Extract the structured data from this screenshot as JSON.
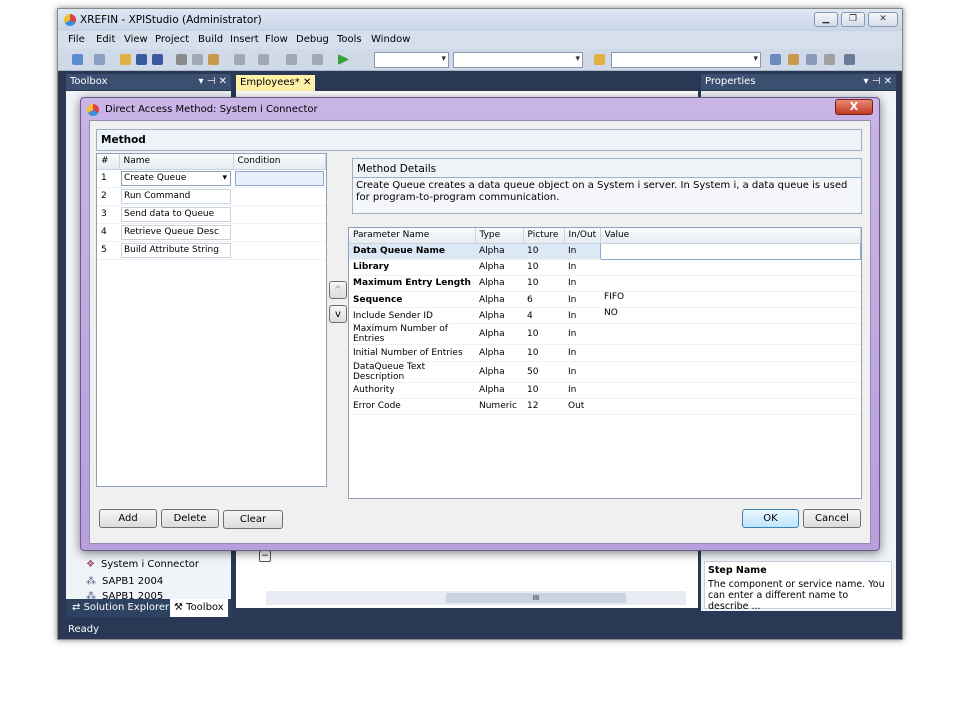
{
  "window": {
    "title": "XREFIN - XPIStudio (Administrator)"
  },
  "menu": [
    "File",
    "Edit",
    "View",
    "Project",
    "Build",
    "Insert",
    "Flow",
    "Debug",
    "Tools",
    "Window"
  ],
  "panels": {
    "toolbox_title": "Toolbox",
    "document_tab": "Employees*",
    "properties_title": "Properties",
    "toolbox_items": [
      "System i Connector",
      "SAPB1 2004",
      "SAPB1 2005"
    ],
    "bottom_tabs": [
      "Solution Explorer",
      "Toolbox"
    ],
    "scroll_center": "III",
    "step_name_title": "Step Name",
    "step_name_desc": "The component or service  name. You can enter a different name to describe ..."
  },
  "status": "Ready",
  "dialog": {
    "title": "Direct Access Method: System i Connector",
    "close_label": "X",
    "method_header": "Method",
    "method_columns": [
      "#",
      "Name",
      "Condition"
    ],
    "methods": [
      {
        "num": "1",
        "name": "Create Queue",
        "condition": ""
      },
      {
        "num": "2",
        "name": "Run Command",
        "condition": ""
      },
      {
        "num": "3",
        "name": "Send data to Queue",
        "condition": ""
      },
      {
        "num": "4",
        "name": "Retrieve Queue Desc",
        "condition": ""
      },
      {
        "num": "5",
        "name": "Build Attribute String",
        "condition": ""
      }
    ],
    "up_label": "^",
    "down_label": "v",
    "details_header": "Method Details",
    "details_text": "Create Queue creates a data queue object on a System i server. In System i, a data queue is used for program-to-program communication.",
    "param_columns": [
      "Parameter Name",
      "Type",
      "Picture",
      "In/Out",
      "Value"
    ],
    "params": [
      {
        "name": "Data Queue Name",
        "bold": true,
        "type": "Alpha",
        "picture": "10",
        "inout": "In",
        "value": ""
      },
      {
        "name": "Library",
        "bold": true,
        "type": "Alpha",
        "picture": "10",
        "inout": "In",
        "value": ""
      },
      {
        "name": "Maximum Entry Length",
        "bold": true,
        "type": "Alpha",
        "picture": "10",
        "inout": "In",
        "value": ""
      },
      {
        "name": "Sequence",
        "bold": true,
        "type": "Alpha",
        "picture": "6",
        "inout": "In",
        "value": "FIFO"
      },
      {
        "name": "Include Sender ID",
        "bold": false,
        "type": "Alpha",
        "picture": "4",
        "inout": "In",
        "value": "NO"
      },
      {
        "name": "Maximum Number of Entries",
        "bold": false,
        "type": "Alpha",
        "picture": "10",
        "inout": "In",
        "value": ""
      },
      {
        "name": "Initial Number of Entries",
        "bold": false,
        "type": "Alpha",
        "picture": "10",
        "inout": "In",
        "value": ""
      },
      {
        "name": "DataQueue Text Description",
        "bold": false,
        "type": "Alpha",
        "picture": "50",
        "inout": "In",
        "value": ""
      },
      {
        "name": "Authority",
        "bold": false,
        "type": "Alpha",
        "picture": "10",
        "inout": "In",
        "value": ""
      },
      {
        "name": "Error Code",
        "bold": false,
        "type": "Numeric",
        "picture": "12",
        "inout": "Out",
        "value": ""
      }
    ],
    "buttons": {
      "add": "Add",
      "delete": "Delete",
      "clear": "Clear",
      "ok": "OK",
      "cancel": "Cancel"
    }
  }
}
